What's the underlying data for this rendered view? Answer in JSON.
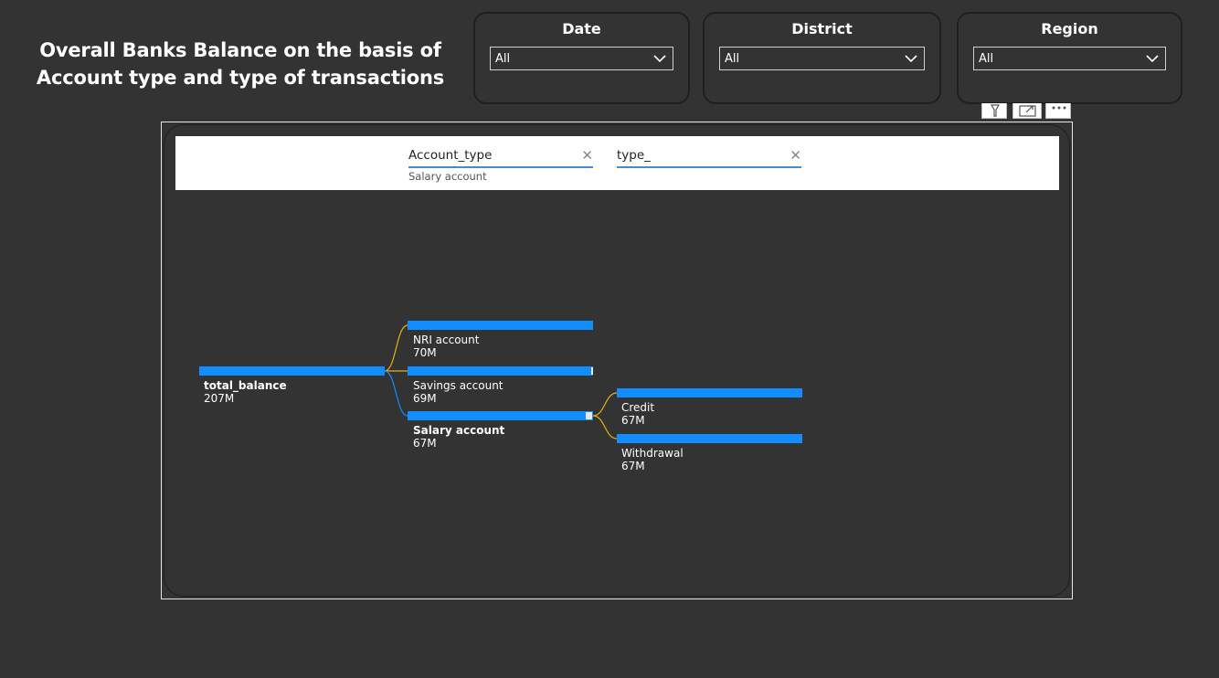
{
  "page": {
    "title": "Overall Banks Balance on the basis of Account type and type of transactions"
  },
  "slicers": [
    {
      "label": "Date",
      "value": "All"
    },
    {
      "label": "District",
      "value": "All"
    },
    {
      "label": "Region",
      "value": "All"
    }
  ],
  "visual_header_icons": [
    "filter-icon",
    "focus-mode-icon",
    "more-options-icon"
  ],
  "decomposition_tree": {
    "levels": [
      {
        "field": "Account_type",
        "selected": "Salary account"
      },
      {
        "field": "type_",
        "selected": ""
      }
    ],
    "root": {
      "name": "total_balance",
      "value_label": "207M"
    },
    "level1": [
      {
        "name": "NRI account",
        "value_label": "70M"
      },
      {
        "name": "Savings account",
        "value_label": "69M"
      },
      {
        "name": "Salary account",
        "value_label": "67M"
      }
    ],
    "level2": [
      {
        "name": "Credit",
        "value_label": "67M"
      },
      {
        "name": "Withdrawal",
        "value_label": "67M"
      }
    ]
  },
  "chart_data": {
    "type": "decomposition_tree",
    "measure": "total_balance",
    "root": {
      "name": "total_balance",
      "value": 207000000
    },
    "children": [
      {
        "name": "NRI account",
        "value": 70000000
      },
      {
        "name": "Savings account",
        "value": 69000000
      },
      {
        "name": "Salary account",
        "value": 67000000,
        "expanded": true,
        "children": [
          {
            "name": "Credit",
            "value": 67000000
          },
          {
            "name": "Withdrawal",
            "value": 67000000
          }
        ]
      }
    ]
  },
  "colors": {
    "background": "#333333",
    "bar": "#118DFF",
    "connector_inactive": "#E8B20E",
    "connector_active": "#118DFF",
    "header_underline": "#3A8FD8"
  }
}
